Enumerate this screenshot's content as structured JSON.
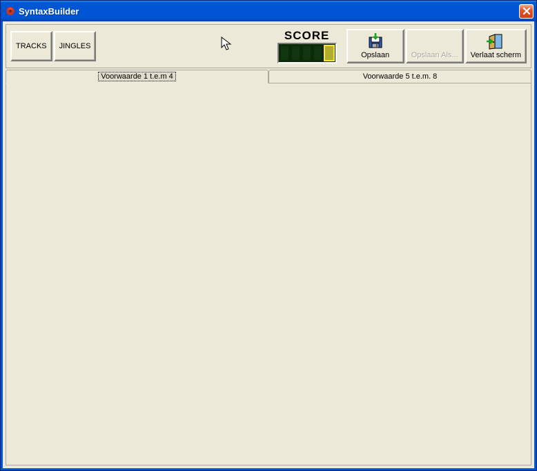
{
  "window": {
    "title": "SyntaxBuilder"
  },
  "toolbar": {
    "tracks_label": "TRACKS",
    "jingles_label": "JINGLES",
    "score_title": "SCORE",
    "opslaan_label": "Opslaan",
    "opslaan_als_label": "Opslaan Als...",
    "verlaat_label": "Verlaat scherm"
  },
  "tabs": {
    "tab1_label": "Voorwaarde 1 t.e.m 4",
    "tab2_label": "Voorwaarde 5 t.e.m. 8",
    "active_index": 0
  },
  "icons": {
    "app": "gear-icon",
    "close": "close-icon",
    "save": "floppy-icon",
    "exit": "exit-door-icon"
  }
}
